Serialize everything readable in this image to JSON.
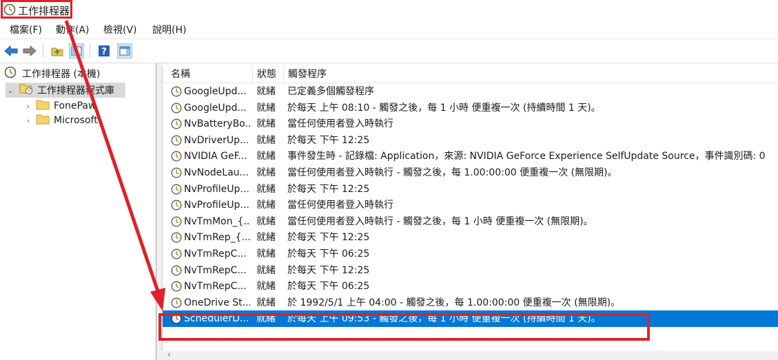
{
  "window": {
    "title": "工作排程器"
  },
  "menu": [
    "檔案(F)",
    "動作(A)",
    "檢視(V)",
    "說明(H)"
  ],
  "toolbar": [
    {
      "name": "back-icon"
    },
    {
      "name": "forward-icon"
    },
    {
      "name": "up-folder-icon"
    },
    {
      "name": "show-hide-tree-icon",
      "pressed": true
    },
    {
      "name": "help-icon"
    },
    {
      "name": "action-pane-icon",
      "pressed": true
    }
  ],
  "tree": {
    "root": "工作排程器 (本機)",
    "library": "工作排程器程式庫",
    "folders": [
      "FonePaw",
      "Microsoft"
    ]
  },
  "columns": {
    "name": "名稱",
    "status": "狀態",
    "trigger": "觸發程序"
  },
  "tasks": [
    {
      "name": "GoogleUpd...",
      "status": "就緒",
      "trigger": "已定義多個觸發程序"
    },
    {
      "name": "GoogleUpd...",
      "status": "就緒",
      "trigger": "於每天 上午 08:10 - 觸發之後，每 1 小時 便重複一次 (持續時間 1 天)。"
    },
    {
      "name": "NvBatteryBo...",
      "status": "就緒",
      "trigger": "當任何使用者登入時執行"
    },
    {
      "name": "NvDriverUp...",
      "status": "就緒",
      "trigger": "於每天 下午 12:25"
    },
    {
      "name": "NVIDIA GeF...",
      "status": "就緒",
      "trigger": "事件發生時 - 記錄檔: Application，來源: NVIDIA GeForce Experience SelfUpdate Source，事件識別碼: 0"
    },
    {
      "name": "NvNodeLau...",
      "status": "就緒",
      "trigger": "當任何使用者登入時執行 - 觸發之後，每 1.00:00:00 便重複一次 (無限期)。"
    },
    {
      "name": "NvProfileUp...",
      "status": "就緒",
      "trigger": "於每天 下午 12:25"
    },
    {
      "name": "NvProfileUp...",
      "status": "就緒",
      "trigger": "當任何使用者登入時執行"
    },
    {
      "name": "NvTmMon_{...",
      "status": "就緒",
      "trigger": "當任何使用者登入時執行 - 觸發之後，每 1 小時 便重複一次 (無限期)。"
    },
    {
      "name": "NvTmRep_{...",
      "status": "就緒",
      "trigger": "於每天 下午 12:25"
    },
    {
      "name": "NvTmRepC...",
      "status": "就緒",
      "trigger": "於每天 下午 06:25"
    },
    {
      "name": "NvTmRepC...",
      "status": "就緒",
      "trigger": "於每天 下午 12:25"
    },
    {
      "name": "NvTmRepC...",
      "status": "就緒",
      "trigger": "於每天 下午 06:25"
    },
    {
      "name": "OneDrive St...",
      "status": "就緒",
      "trigger": "於 1992/5/1 上午 04:00 - 觸發之後，每 1.00:00:00 便重複一次 (無限期)。"
    },
    {
      "name": "SchedulerD...",
      "status": "就緒",
      "trigger": "於每天 上午 09:53 - 觸發之後，每 1 小時 便重複一次 (持續時間 1 天)。",
      "selected": true
    }
  ],
  "colors": {
    "selection": "#0078d7",
    "annotation": "#e0202a"
  }
}
